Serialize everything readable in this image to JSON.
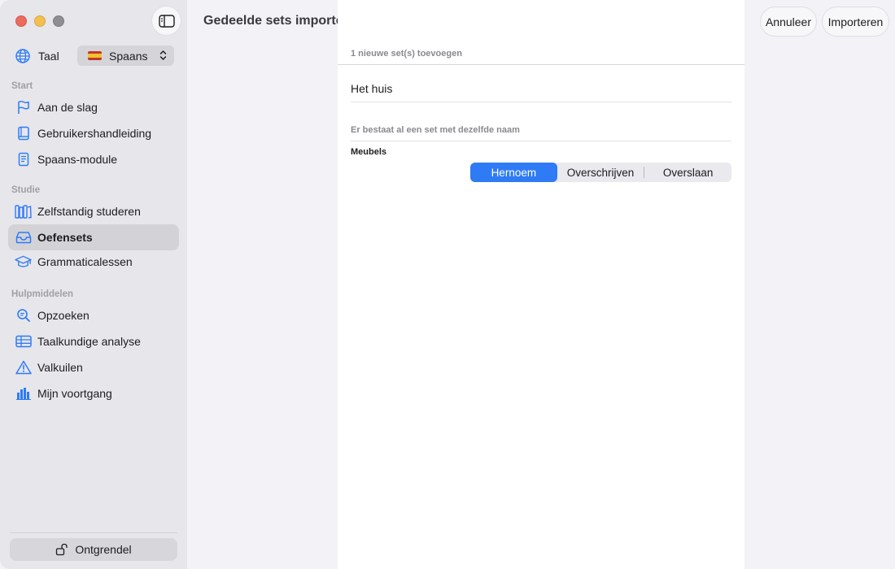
{
  "header": {
    "title": "Gedeelde sets importeren",
    "cancel_label": "Annuleer",
    "import_label": "Importeren"
  },
  "sidebar": {
    "language_label": "Taal",
    "language_value": "Spaans",
    "sections": {
      "start": "Start",
      "study": "Studie",
      "tools": "Hulpmiddelen"
    },
    "items": [
      {
        "label": "Aan de slag",
        "icon": "flag-icon"
      },
      {
        "label": "Gebruikershandleiding",
        "icon": "book-icon"
      },
      {
        "label": "Spaans-module",
        "icon": "document-icon"
      },
      {
        "label": "Zelfstandig studeren",
        "icon": "books-icon"
      },
      {
        "label": "Oefensets",
        "icon": "tray-icon",
        "active": true
      },
      {
        "label": "Grammaticalessen",
        "icon": "graduation-cap-icon"
      },
      {
        "label": "Opzoeken",
        "icon": "magnifier-icon"
      },
      {
        "label": "Taalkundige analyse",
        "icon": "table-icon"
      },
      {
        "label": "Valkuilen",
        "icon": "warning-icon"
      },
      {
        "label": "Mijn voortgang",
        "icon": "bar-chart-icon"
      }
    ],
    "unlock_label": "Ontgrendel"
  },
  "import": {
    "new_sets_caption": "1 nieuwe set(s) toevoegen",
    "new_set_name": "Het huis",
    "conflict_caption": "Er bestaat al een set met dezelfde naam",
    "conflict_set_name": "Meubels",
    "options": [
      "Hernoem",
      "Overschrijven",
      "Overslaan"
    ],
    "selected_option": "Hernoem"
  },
  "colors": {
    "accent": "#2f7bf5",
    "sidebar_bg": "#e6e6eb",
    "icon_blue": "#2f7bf5"
  }
}
